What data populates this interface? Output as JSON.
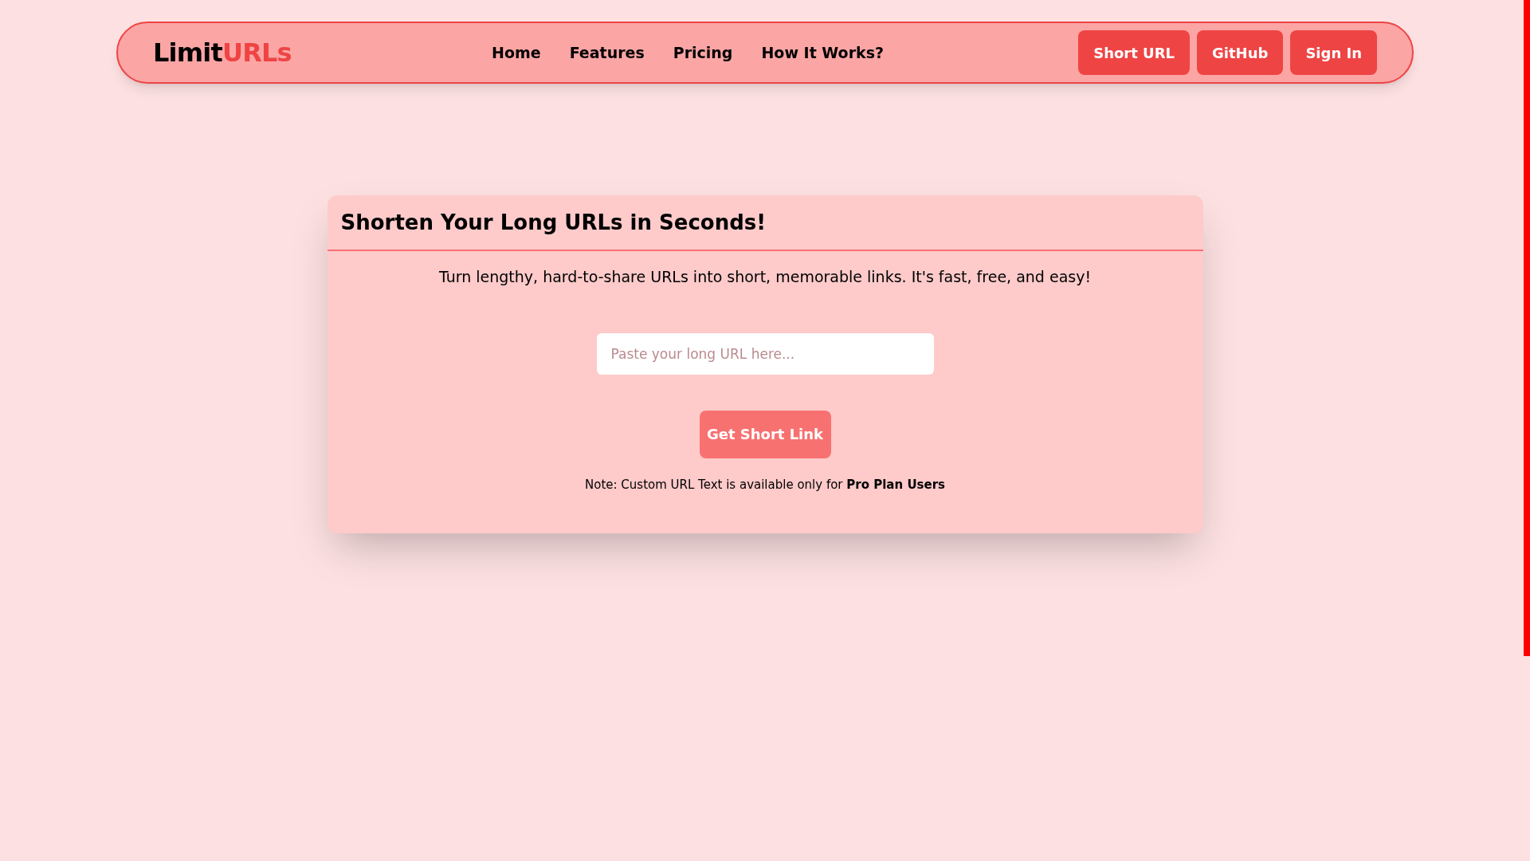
{
  "navbar": {
    "logo": {
      "part_1": "Limit",
      "part_2": "URLs"
    },
    "links": [
      {
        "label": "Home"
      },
      {
        "label": "Features"
      },
      {
        "label": "Pricing"
      },
      {
        "label": "How It Works?"
      }
    ],
    "buttons": [
      {
        "label": "Short URL"
      },
      {
        "label": "GitHub"
      },
      {
        "label": "Sign In"
      }
    ]
  },
  "card": {
    "title": "Shorten Your Long URLs in Seconds!",
    "subtitle": "Turn lengthy, hard-to-share URLs into short, memorable links. It's fast, free, and easy!",
    "url_field": {
      "placeholder": "Paste your long URL here..."
    },
    "submit_button": "Get Short Link",
    "note": "Note: Custom URL Text is available only for **Pro Plan Users**"
  }
}
